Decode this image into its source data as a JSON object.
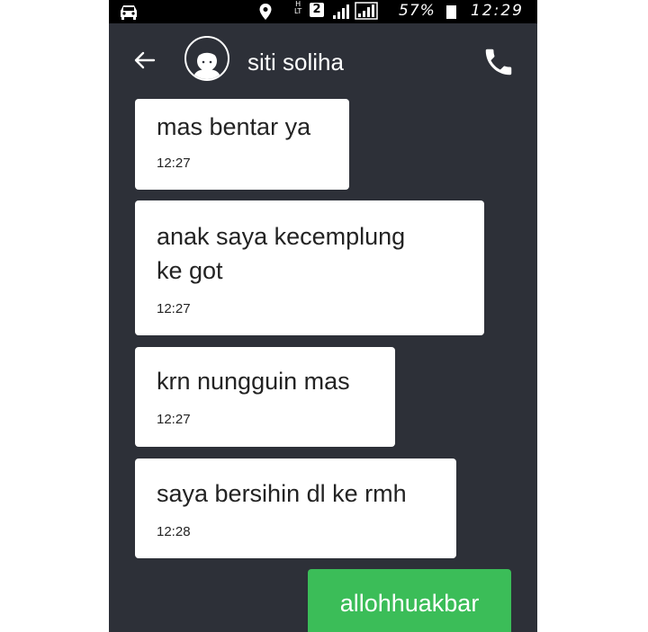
{
  "status_bar": {
    "network_type": "H",
    "network_sub": "LT",
    "sim_slot": "2",
    "battery": "57%",
    "time": "12:29",
    "icons": [
      "car-icon",
      "location-pin-icon",
      "signal-icon",
      "battery-icon"
    ]
  },
  "header": {
    "contact_name": "siti soliha",
    "icons": [
      "back-arrow-icon",
      "avatar",
      "phone-call-icon"
    ]
  },
  "messages": [
    {
      "direction": "incoming",
      "text": "mas bentar ya",
      "time": "12:27"
    },
    {
      "direction": "incoming",
      "text_lines": [
        "anak saya kecemplung",
        "ke got"
      ],
      "time": "12:27"
    },
    {
      "direction": "incoming",
      "text": "krn nungguin mas",
      "time": "12:27"
    },
    {
      "direction": "incoming",
      "text": "saya bersihin dl ke rmh",
      "time": "12:28"
    },
    {
      "direction": "outgoing",
      "text": "allohhuakbar"
    }
  ],
  "colors": {
    "chat_background": "#2d3038",
    "incoming_bubble": "#ffffff",
    "outgoing_bubble": "#3bbd58",
    "status_bar": "#000000"
  }
}
